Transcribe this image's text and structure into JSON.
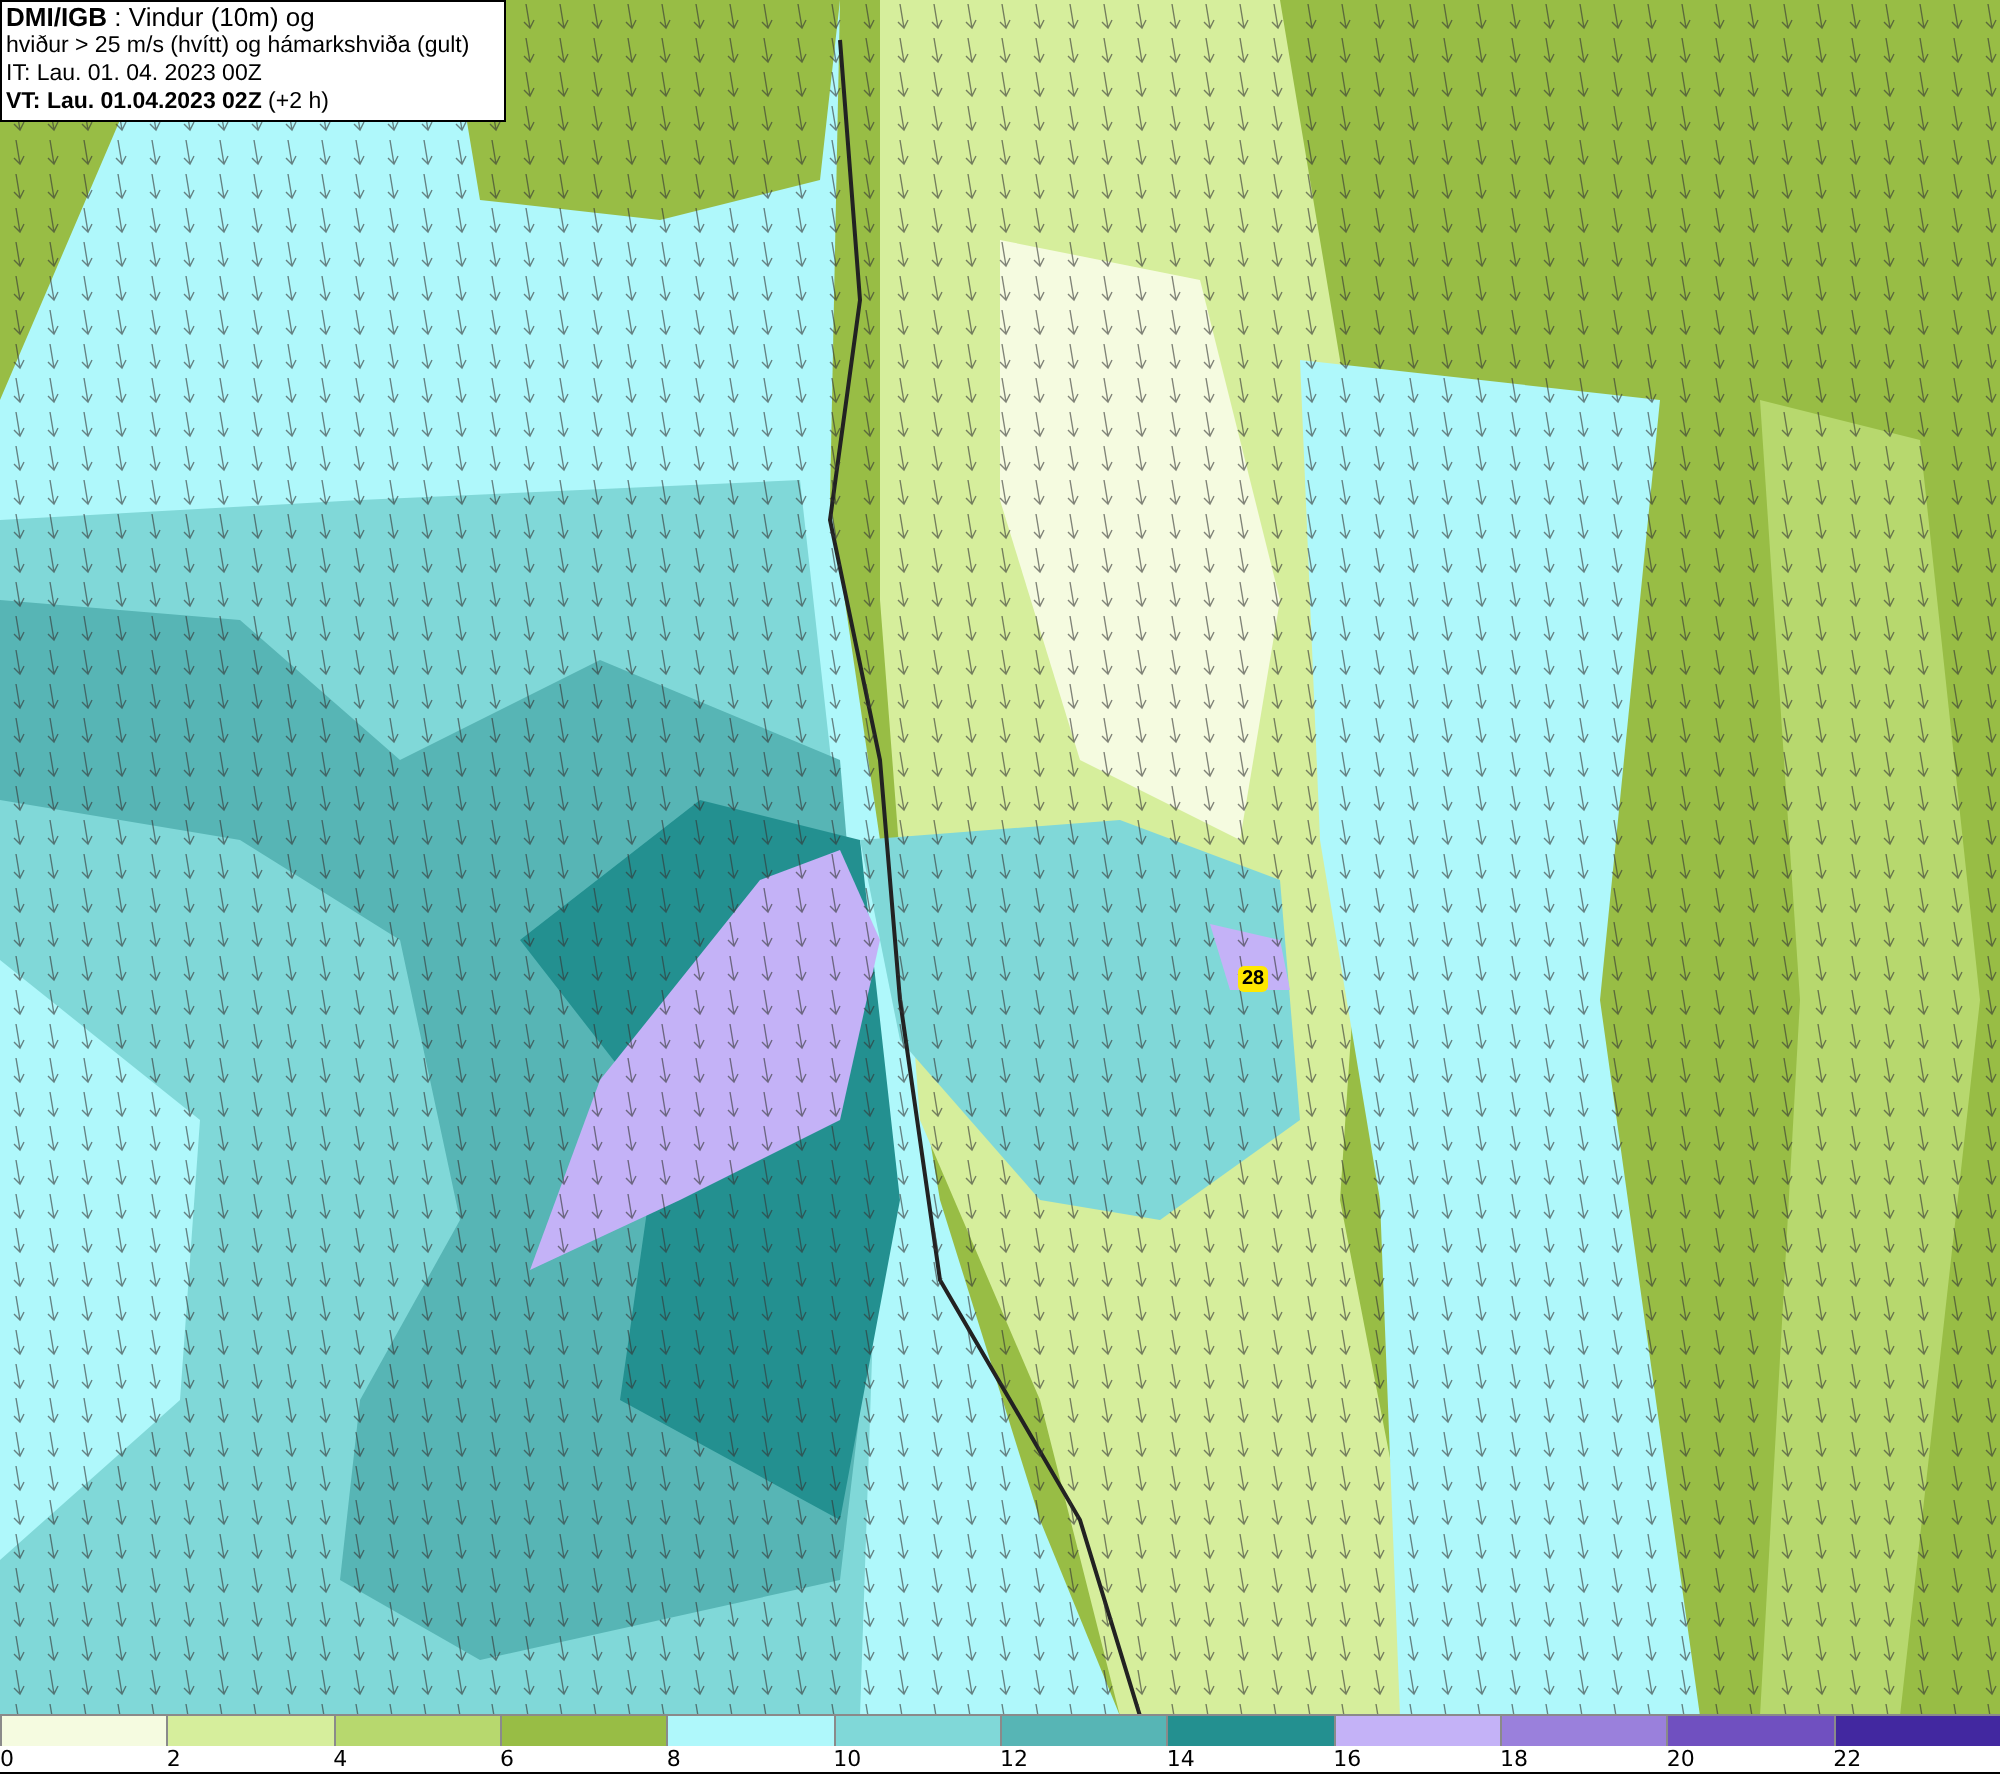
{
  "header": {
    "line_1": "**DMI/IGB** : Vindur (10m) og",
    "line_2": "hviður > 25 m/s (hvítt) og hámarkshviða (gult)",
    "line_3": "IT: Lau. 01. 04. 2023 00Z",
    "line_4": "**VT: Lau. 01.04.2023 02Z** (+2 h)"
  },
  "map": {
    "gust_label": "28"
  },
  "legend": {
    "bins": [
      {
        "label": "0",
        "color": "#f5fbe0"
      },
      {
        "label": "2",
        "color": "#d6ee9c"
      },
      {
        "label": "4",
        "color": "#b7d86e"
      },
      {
        "label": "6",
        "color": "#98bd45"
      },
      {
        "label": "8",
        "color": "#aff8fb"
      },
      {
        "label": "10",
        "color": "#80d8d8"
      },
      {
        "label": "12",
        "color": "#57b5b5"
      },
      {
        "label": "14",
        "color": "#239090"
      },
      {
        "label": "16",
        "color": "#c4b2f7"
      },
      {
        "label": "18",
        "color": "#9a80dc"
      },
      {
        "label": "20",
        "color": "#7050c0"
      },
      {
        "label": "22",
        "color": "#4228a0"
      }
    ]
  }
}
